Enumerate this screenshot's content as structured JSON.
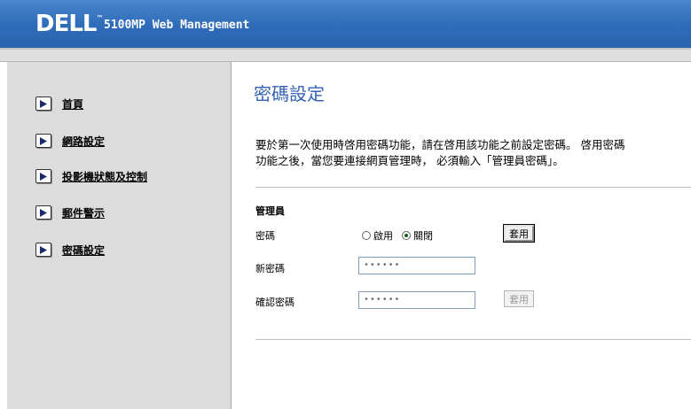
{
  "header": {
    "logo_text": "DELL",
    "logo_tm": "™",
    "app_title": "5100MP Web Management"
  },
  "sidebar": {
    "items": [
      {
        "label": "首頁",
        "icon": "play-arrow-icon"
      },
      {
        "label": "網路設定",
        "icon": "play-arrow-icon"
      },
      {
        "label": "投影機狀態及控制",
        "icon": "play-arrow-icon"
      },
      {
        "label": "郵件警示",
        "icon": "play-arrow-icon"
      },
      {
        "label": "密碼設定",
        "icon": "play-arrow-icon"
      }
    ]
  },
  "main": {
    "title": "密碼設定",
    "description": "要於第一次使用時啓用密碼功能，請在啓用該功能之前設定密碼。 啓用密碼\n功能之後，當您要連接網頁管理時， 必須輸入「管理員密碼」。",
    "section_label": "管理員",
    "password_label": "密碼",
    "radio_enable": "啟用",
    "radio_disable": "關閉",
    "radio_selected": "關閉",
    "apply_label_1": "套用",
    "new_password_label": "新密碼",
    "new_password_value": "••••••",
    "confirm_password_label": "確認密碼",
    "confirm_password_value": "••••••",
    "apply_label_2": "套用"
  },
  "colors": {
    "header_blue": "#2e6bb8",
    "title_blue": "#3663b5",
    "sidebar_gray": "#dcdcdc"
  }
}
